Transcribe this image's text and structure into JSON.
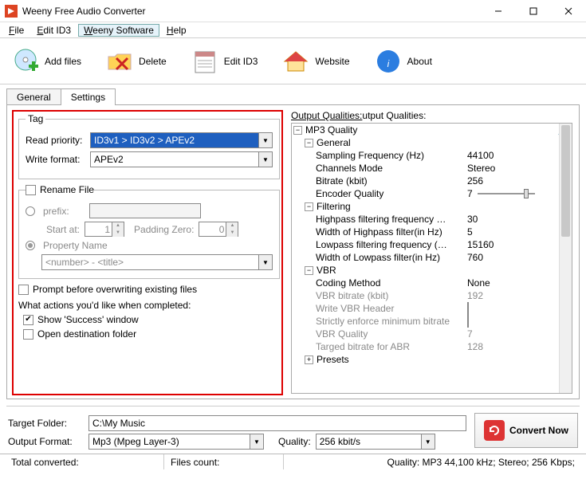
{
  "title": "Weeny Free Audio Converter",
  "menu": {
    "file": "File",
    "edit": "Edit ID3",
    "weeny": "Weeny Software",
    "help": "Help"
  },
  "toolbar": {
    "addfiles": "Add files",
    "delete": "Delete",
    "editid3": "Edit ID3",
    "website": "Website",
    "about": "About"
  },
  "tabs": {
    "general": "General",
    "settings": "Settings"
  },
  "tag": {
    "legend": "Tag",
    "read_label": "Read priority:",
    "read_value": "ID3v1 > ID3v2 > APEv2",
    "write_label": "Write format:",
    "write_value": "APEv2"
  },
  "rename": {
    "chk": "Rename File",
    "prefix": "prefix:",
    "startat": "Start at:",
    "startat_val": "1",
    "padzero": "Padding Zero:",
    "padzero_val": "0",
    "propname": "Property Name",
    "proptpl": "<number> - <title>"
  },
  "opts": {
    "prompt": "Prompt before overwriting existing files",
    "actions": "What actions you'd like when completed:",
    "show_success": "Show 'Success' window",
    "open_dest": "Open destination folder"
  },
  "oq": {
    "header": "Output Qualities:",
    "mp3": "MP3 Quality",
    "general": "General",
    "g": {
      "samp_k": "Sampling Frequency (Hz)",
      "samp_v": "44100",
      "ch_k": "Channels Mode",
      "ch_v": "Stereo",
      "br_k": "Bitrate (kbit)",
      "br_v": "256",
      "eq_k": "Encoder Quality",
      "eq_v": "7"
    },
    "filtering": "Filtering",
    "f": {
      "hp_k": "Highpass filtering frequency …",
      "hp_v": "30",
      "hpw_k": "Width of Highpass filter(in Hz)",
      "hpw_v": "5",
      "lp_k": "Lowpass filtering frequency (…",
      "lp_v": "15160",
      "lpw_k": "Width of Lowpass filter(in Hz)",
      "lpw_v": "760"
    },
    "vbr": "VBR",
    "v": {
      "cm_k": "Coding Method",
      "cm_v": "None",
      "vb_k": "VBR bitrate (kbit)",
      "vb_v": "192",
      "wh_k": "Write VBR Header",
      "se_k": "Strictly enforce minimum bitrate",
      "vq_k": "VBR Quality",
      "vq_v": "7",
      "tb_k": "Targed bitrate for ABR",
      "tb_v": "128"
    },
    "presets": "Presets"
  },
  "bottom": {
    "target_lbl": "Target Folder:",
    "target_val": "C:\\My Music",
    "outfmt_lbl": "Output Format:",
    "outfmt_val": "Mp3 (Mpeg Layer-3)",
    "quality_lbl": "Quality:",
    "quality_val": "256 kbit/s",
    "convert": "Convert Now"
  },
  "status": {
    "total": "Total converted:",
    "files": "Files count:",
    "quality": "Quality: MP3 44,100 kHz; Stereo;  256 Kbps;"
  }
}
